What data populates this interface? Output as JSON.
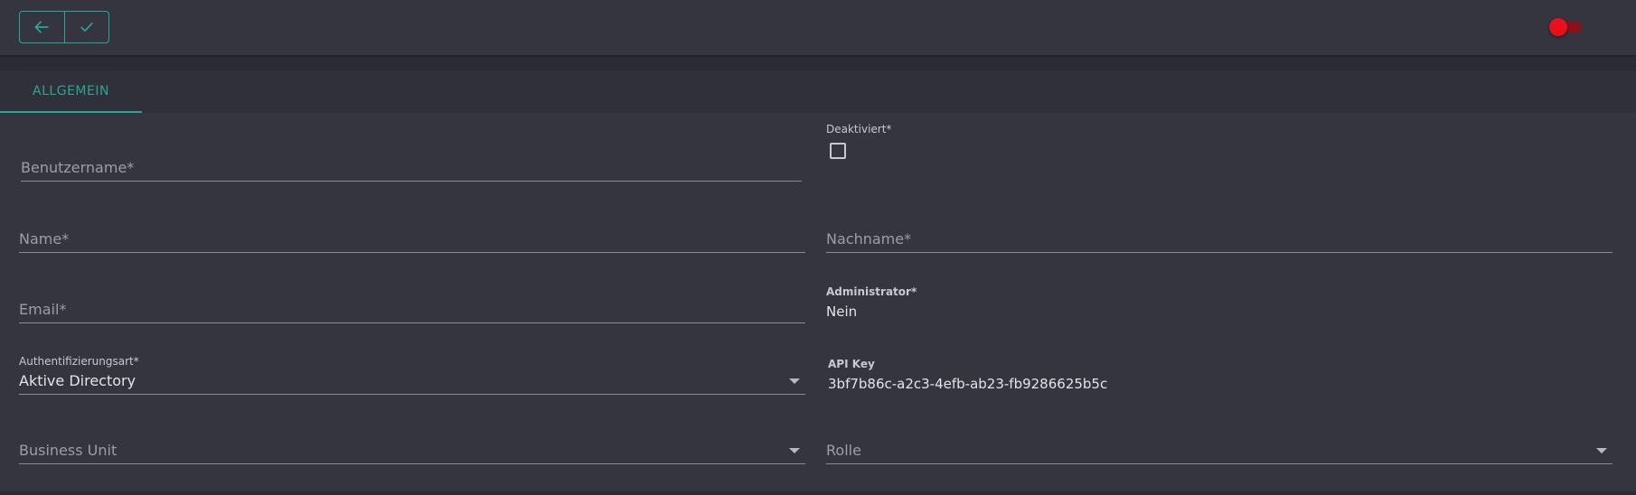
{
  "toolbar": {
    "back_icon": "arrow-left-icon",
    "save_icon": "check-icon",
    "accent_color": "#29a69a",
    "toggle_color": "#e8101a",
    "toggle_on": false
  },
  "tabs": [
    {
      "label": "ALLGEMEIN",
      "active": true
    }
  ],
  "form": {
    "username": {
      "placeholder": "Benutzername*",
      "value": ""
    },
    "deactivated": {
      "label": "Deaktiviert*",
      "checked": false
    },
    "first_name": {
      "placeholder": "Name*",
      "value": ""
    },
    "last_name": {
      "placeholder": "Nachname*",
      "value": ""
    },
    "email": {
      "placeholder": "Email*",
      "value": ""
    },
    "administrator": {
      "label": "Administrator*",
      "value": "Nein"
    },
    "auth_type": {
      "label": "Authentifizierungsart*",
      "value": "Aktive Directory"
    },
    "api_key": {
      "label": "API Key",
      "value": "3bf7b86c-a2c3-4efb-ab23-fb9286625b5c"
    },
    "business_unit": {
      "placeholder": "Business Unit",
      "value": ""
    },
    "role": {
      "placeholder": "Rolle",
      "value": ""
    }
  }
}
